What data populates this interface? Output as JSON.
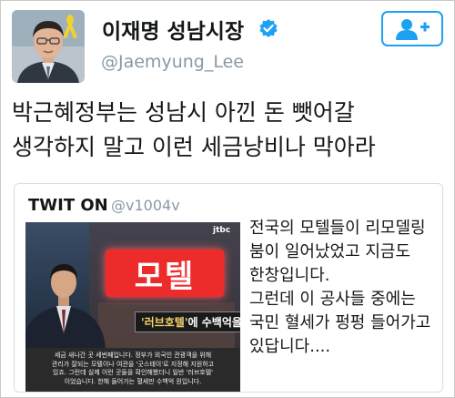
{
  "author": {
    "name": "이재명 성남시장",
    "handle": "@Jaemyung_Lee",
    "verified": true,
    "avatar_icon": "person-avatar-with-yellow-ribbon"
  },
  "follow_button": {
    "icon": "follow-user-plus-icon",
    "color": "#1da1f2"
  },
  "tweet": {
    "lines": [
      "박근혜정부는 성남시 아낀 돈 뺏어갈",
      "생각하지 말고 이런 세금낭비나 막아라"
    ]
  },
  "quote": {
    "name": "TWIT ON",
    "handle": "@v1004v",
    "lines": [
      "전국의 모텔들이 리모델링",
      "붐이 일어났었고 지금도",
      "한창입니다.",
      "그런데 이 공사들 중에는",
      "국민 혈세가 펑펑 들어가고",
      "있답니다...."
    ],
    "image": {
      "network": "jtbc",
      "sign_text": "모텔",
      "caption_prefix": "'러브호텔'",
      "caption_suffix": "에 수백억을?",
      "subtitle_lines": [
        "세금 새나간 곳 세번째입니다. 정부가 외국인 관광객을 위해",
        "관리가 잘되는 모텔이나 여관을 '굿스테이'로 지정해 지원하고",
        "있죠. 그런데 실제 이런 곳들을 확인해봤더니 일반 '러브호텔'",
        "이었습니다. 한해 들어가는 혈세만 수백억 원입니다."
      ]
    }
  },
  "colors": {
    "accent": "#1da1f2",
    "verified": "#1da1f2",
    "handle_gray": "#8899a6",
    "sign_red": "#ee2b2b"
  }
}
